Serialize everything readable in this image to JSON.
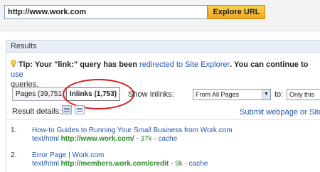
{
  "url_bar": {
    "value": "http://www.work.com",
    "button_label": "Explore URL"
  },
  "panel": {
    "title": "Results"
  },
  "tip": {
    "prefix": "Tip: Your \"link:\" query has been ",
    "link_text": "redirected to Site Explorer",
    "middle": ". You can continue to ",
    "link2_text": "use",
    "suffix": "queries."
  },
  "tabs": {
    "pages_label": "Pages (39,751",
    "inlinks_label": "Inlinks (1,753)"
  },
  "filters": {
    "show_inlinks_label": "Show Inlinks:",
    "from_value": "From All Pages",
    "to_label": "to:",
    "to_value": "Only this URL"
  },
  "details": {
    "label": "Result details:",
    "submit_link": "Submit webpage or Site"
  },
  "results": [
    {
      "number": "1.",
      "title": "How-to Guides to Running Your Small Business from Work.com",
      "type": "text/html",
      "url": "http://www.work.com/",
      "size": "37k",
      "cache": "cache"
    },
    {
      "number": "2.",
      "title": "Error Page | Work.com",
      "type": "text/html",
      "url": "http://members.work.com/credit",
      "size": "9k",
      "cache": "cache"
    }
  ],
  "colors": {
    "accent_link": "#2255aa",
    "url_green": "#2a8a2a",
    "highlight_oval": "#d42020",
    "button_orange": "#f0a623"
  }
}
